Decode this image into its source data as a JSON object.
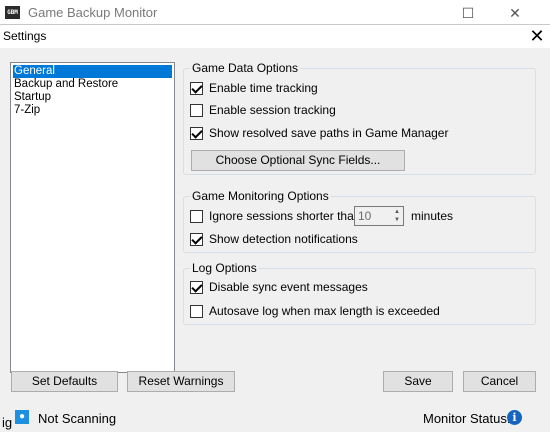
{
  "main_window": {
    "title": "Game Backup Monitor",
    "logo_text": "GBM"
  },
  "dialog": {
    "title": "Settings",
    "nav_items": [
      "General",
      "Backup and Restore",
      "Startup",
      "7-Zip"
    ],
    "game_data_options": {
      "title": "Game Data Options",
      "enable_time_tracking": "Enable time tracking",
      "enable_session_tracking": "Enable session tracking",
      "show_resolved_paths": "Show resolved save paths in Game Manager",
      "choose_sync_fields": "Choose Optional Sync Fields..."
    },
    "game_monitoring_options": {
      "title": "Game Monitoring Options",
      "ignore_sessions": "Ignore sessions shorter than",
      "minutes_value": "10",
      "minutes_label": "minutes",
      "show_detection": "Show detection notifications"
    },
    "log_options": {
      "title": "Log Options",
      "disable_sync": "Disable sync event messages",
      "autosave_log": "Autosave log when max length is exceeded"
    },
    "buttons": {
      "set_defaults": "Set Defaults",
      "reset_warnings": "Reset Warnings",
      "save": "Save",
      "cancel": "Cancel"
    }
  },
  "statusbar": {
    "fragment": "ig",
    "status": "Not Scanning",
    "monitor_label": "Monitor Status:"
  },
  "checkbox_states": {
    "enable_time_tracking": true,
    "enable_session_tracking": false,
    "show_resolved_paths": true,
    "ignore_sessions": false,
    "show_detection": true,
    "disable_sync": true,
    "autosave_log": false
  },
  "colors": {
    "selection": "#0078d7",
    "dialog_bg": "#f0f0f0",
    "info_icon": "#1565c0"
  }
}
